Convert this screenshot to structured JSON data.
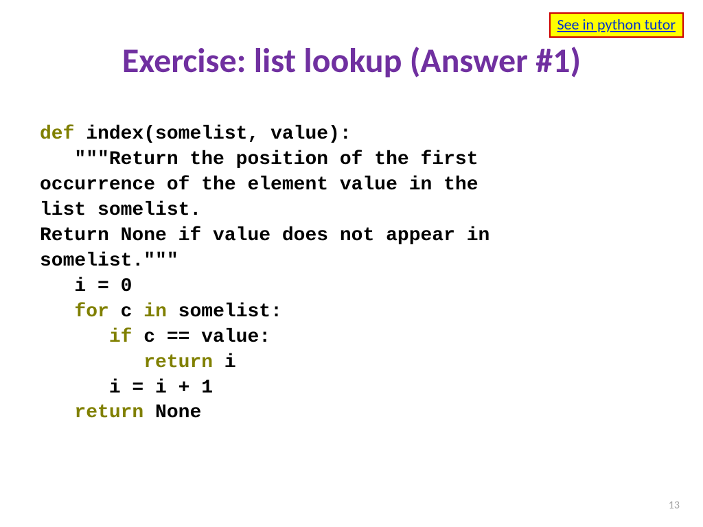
{
  "link": {
    "label": "See in python tutor"
  },
  "title": "Exercise:  list lookup (Answer #1)",
  "code": {
    "kw_def": "def",
    "sig": " index(somelist, value):",
    "doc1": "   \"\"\"Return the position of the first",
    "doc2": "occurrence of the element value in the",
    "doc3": "list somelist.",
    "doc4": "Return None if value does not appear in",
    "doc5": "somelist.\"\"\"",
    "l_i0": "   i = 0",
    "l_for_pre": "   ",
    "kw_for": "for",
    "l_for_mid": " c ",
    "kw_in": "in",
    "l_for_post": " somelist:",
    "l_if_pre": "      ",
    "kw_if": "if",
    "l_if_post": " c == value:",
    "l_ret_pre": "         ",
    "kw_return1": "return",
    "l_ret_post": " i",
    "l_inc": "      i = i + 1",
    "l_retnone_pre": "   ",
    "kw_return2": "return",
    "l_retnone_post": " None"
  },
  "page_number": "13"
}
